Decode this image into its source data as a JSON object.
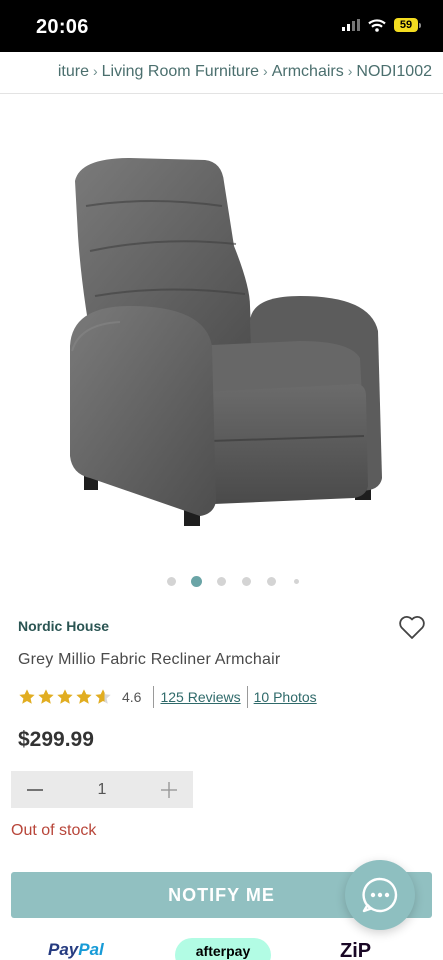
{
  "status_bar": {
    "time": "20:06",
    "battery": "59"
  },
  "breadcrumb": {
    "items": [
      "iture",
      "Living Room Furniture",
      "Armchairs",
      "NODI1002"
    ],
    "separator": "›"
  },
  "carousel": {
    "count": 6,
    "active_index": 1
  },
  "product": {
    "brand": "Nordic House",
    "title": "Grey Millio Fabric Recliner Armchair",
    "rating": "4.6",
    "reviews_link": "125 Reviews",
    "photos_link": "10 Photos",
    "price": "$299.99",
    "stock_status": "Out of stock"
  },
  "quantity": {
    "value": "1"
  },
  "actions": {
    "notify_label": "NOTIFY ME"
  },
  "payments": {
    "paypal_pay": "Pay",
    "paypal_pal": "Pal",
    "afterpay": "afterpay",
    "zip": "ZiP"
  },
  "colors": {
    "accent": "#6aa4a6",
    "button": "#91c0c1",
    "brand_text": "#2b5553",
    "out_of_stock": "#b8463a",
    "star": "#e1ad21"
  },
  "icons": [
    "signal-icon",
    "wifi-icon",
    "battery-icon",
    "heart-icon",
    "star-icon",
    "minus-icon",
    "plus-icon",
    "chat-icon"
  ]
}
